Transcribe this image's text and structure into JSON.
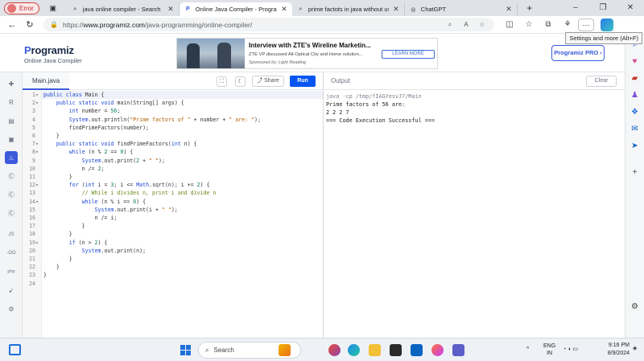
{
  "browser": {
    "profile_label": "Error",
    "tabs": [
      {
        "title": "java online compiler - Search",
        "icon": "search-icon",
        "active": false
      },
      {
        "title": "Online Java Compiler - Programiz",
        "icon": "programiz-icon",
        "active": true
      },
      {
        "title": "prime factots in java without usin",
        "icon": "search-icon",
        "active": false
      },
      {
        "title": "ChatGPT",
        "icon": "chatgpt-icon",
        "active": false
      }
    ],
    "url_prefix": "https://",
    "url_host": "www.programiz.com",
    "url_path": "/java-programming/online-compiler/",
    "tooltip": "Settings and more (Alt+F)"
  },
  "header": {
    "logo": "rogramiz",
    "logo_letter": "P",
    "subtitle": "Online Java Compiler",
    "pro_button": "Programiz PRO ›"
  },
  "ad": {
    "title": "Interview with ZTE's Wireline Marketin...",
    "description": "ZTE VP discussed All-Optical City and Home solution...",
    "sponsor": "Sponsored by: Light Reading",
    "cta": "LEARN MORE"
  },
  "editor": {
    "file_tab": "Main.java",
    "share_label": "Share",
    "run_label": "Run",
    "lines": [
      {
        "n": "1",
        "fold": "▾",
        "code": "public class Main {"
      },
      {
        "n": "2",
        "fold": "▾",
        "code": "    public static void main(String[] args) {"
      },
      {
        "n": "3",
        "fold": "",
        "code": "        int number = 56;"
      },
      {
        "n": "4",
        "fold": "",
        "code": "        System.out.println(\"Prime factors of \" + number + \" are: \");"
      },
      {
        "n": "5",
        "fold": "",
        "code": "        findPrimeFactors(number);"
      },
      {
        "n": "6",
        "fold": "",
        "code": "    }"
      },
      {
        "n": "7",
        "fold": "▾",
        "code": "    public static void findPrimeFactors(int n) {"
      },
      {
        "n": "8",
        "fold": "▾",
        "code": "        while (n % 2 == 0) {"
      },
      {
        "n": "9",
        "fold": "",
        "code": "            System.out.print(2 + \" \");"
      },
      {
        "n": "10",
        "fold": "",
        "code": "            n /= 2;"
      },
      {
        "n": "11",
        "fold": "",
        "code": "        }"
      },
      {
        "n": "12",
        "fold": "▾",
        "code": "        for (int i = 3; i <= Math.sqrt(n); i += 2) {"
      },
      {
        "n": "13",
        "fold": "",
        "code": "            // While i divides n, print i and divide n"
      },
      {
        "n": "14",
        "fold": "▾",
        "code": "            while (n % i == 0) {"
      },
      {
        "n": "15",
        "fold": "",
        "code": "                System.out.print(i + \" \");"
      },
      {
        "n": "16",
        "fold": "",
        "code": "                n /= i;"
      },
      {
        "n": "17",
        "fold": "",
        "code": "            }"
      },
      {
        "n": "18",
        "fold": "",
        "code": "        }"
      },
      {
        "n": "19",
        "fold": "▾",
        "code": "        if (n > 2) {"
      },
      {
        "n": "20",
        "fold": "",
        "code": "            System.out.print(n);"
      },
      {
        "n": "21",
        "fold": "",
        "code": "        }"
      },
      {
        "n": "22",
        "fold": "",
        "code": "    }"
      },
      {
        "n": "23",
        "fold": "",
        "code": "}"
      },
      {
        "n": "24",
        "fold": "",
        "code": ""
      }
    ]
  },
  "output": {
    "title": "Output",
    "clear_label": "Clear",
    "lines": [
      "java -cp /tmp/fIAGYesvJ7/Main",
      "Prime factors of 56 are:",
      "2 2 2 7",
      "=== Code Execution Successful ==="
    ]
  },
  "rail": {
    "items": [
      "python-icon",
      "r-icon",
      "sql-icon",
      "html-icon",
      "java-icon",
      "c-icon",
      "cpp-icon",
      "csharp-icon",
      "js-icon",
      "go-icon",
      "php-icon",
      "swift-icon",
      "rust-icon"
    ],
    "labels": {
      "js": "JS",
      "go": "-GO",
      "php": "php"
    }
  },
  "taskbar": {
    "search_placeholder": "Search",
    "lang": "ENG",
    "region": "IN",
    "time": "9:16 PM",
    "date": "8/9/2024"
  },
  "colors": {
    "accent": "#3b5bdb",
    "run": "#0556f3",
    "keyword": "#1f49d1",
    "string": "#b26100"
  }
}
